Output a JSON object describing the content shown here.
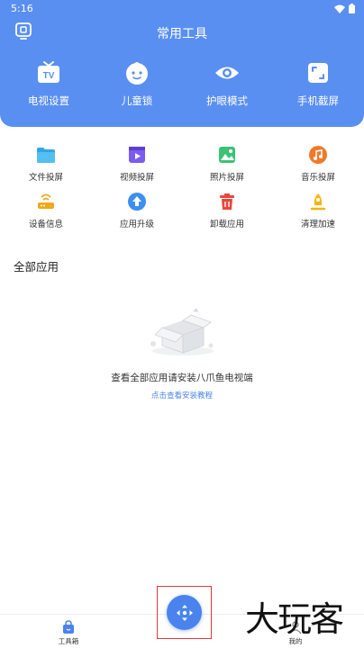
{
  "status_bar": {
    "time": "5:16"
  },
  "header": {
    "title": "常用工具"
  },
  "top_tools": [
    {
      "label": "电视设置",
      "icon": "tv-icon"
    },
    {
      "label": "儿童锁",
      "icon": "child-face-icon"
    },
    {
      "label": "护眼模式",
      "icon": "eye-icon"
    },
    {
      "label": "手机截屏",
      "icon": "screenshot-icon"
    }
  ],
  "tools": [
    {
      "label": "文件投屏",
      "icon": "folder-icon",
      "color": "#2fa6e8"
    },
    {
      "label": "视频投屏",
      "icon": "video-icon",
      "color": "#7b5cf0"
    },
    {
      "label": "照片投屏",
      "icon": "photo-icon",
      "color": "#3cc277"
    },
    {
      "label": "音乐投屏",
      "icon": "music-icon",
      "color": "#f07a2a"
    },
    {
      "label": "设备信息",
      "icon": "router-icon",
      "color": "#f2a81c"
    },
    {
      "label": "应用升级",
      "icon": "upgrade-icon",
      "color": "#3d8ff0"
    },
    {
      "label": "卸载应用",
      "icon": "trash-icon",
      "color": "#e8473c"
    },
    {
      "label": "清理加速",
      "icon": "rocket-icon",
      "color": "#f5b50f"
    }
  ],
  "section": {
    "title": "全部应用"
  },
  "empty_state": {
    "message": "查看全部应用请安装八爪鱼电视端",
    "link": "点击查看安装教程"
  },
  "bottom_nav": {
    "left_label": "工具箱",
    "right_label": "我的"
  },
  "watermark": {
    "text": "大玩客"
  },
  "colors": {
    "accent": "#5a8ff2",
    "link": "#4a83ee",
    "highlight": "#e0383e"
  }
}
